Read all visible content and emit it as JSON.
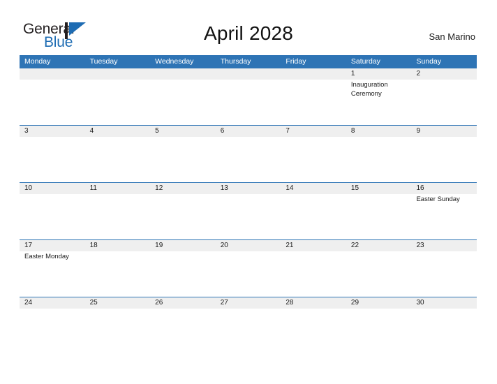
{
  "brand": {
    "name_part1": "General",
    "name_part2": "Blue",
    "mark": "flag-triangle-icon",
    "accent_color": "#1e6cb3"
  },
  "header": {
    "title": "April 2028",
    "locale": "San Marino"
  },
  "colors": {
    "header_blue": "#2e74b5",
    "daynum_band_gray": "#efefef",
    "cell_background": "#fdfdfd",
    "text": "#1a1a1a"
  },
  "calendar": {
    "weekdays": [
      "Monday",
      "Tuesday",
      "Wednesday",
      "Thursday",
      "Friday",
      "Saturday",
      "Sunday"
    ],
    "weeks": [
      [
        {
          "day": "",
          "event": ""
        },
        {
          "day": "",
          "event": ""
        },
        {
          "day": "",
          "event": ""
        },
        {
          "day": "",
          "event": ""
        },
        {
          "day": "",
          "event": ""
        },
        {
          "day": "1",
          "event": "Inauguration Ceremony"
        },
        {
          "day": "2",
          "event": ""
        }
      ],
      [
        {
          "day": "3",
          "event": ""
        },
        {
          "day": "4",
          "event": ""
        },
        {
          "day": "5",
          "event": ""
        },
        {
          "day": "6",
          "event": ""
        },
        {
          "day": "7",
          "event": ""
        },
        {
          "day": "8",
          "event": ""
        },
        {
          "day": "9",
          "event": ""
        }
      ],
      [
        {
          "day": "10",
          "event": ""
        },
        {
          "day": "11",
          "event": ""
        },
        {
          "day": "12",
          "event": ""
        },
        {
          "day": "13",
          "event": ""
        },
        {
          "day": "14",
          "event": ""
        },
        {
          "day": "15",
          "event": ""
        },
        {
          "day": "16",
          "event": "Easter Sunday"
        }
      ],
      [
        {
          "day": "17",
          "event": "Easter Monday"
        },
        {
          "day": "18",
          "event": ""
        },
        {
          "day": "19",
          "event": ""
        },
        {
          "day": "20",
          "event": ""
        },
        {
          "day": "21",
          "event": ""
        },
        {
          "day": "22",
          "event": ""
        },
        {
          "day": "23",
          "event": ""
        }
      ],
      [
        {
          "day": "24",
          "event": ""
        },
        {
          "day": "25",
          "event": ""
        },
        {
          "day": "26",
          "event": ""
        },
        {
          "day": "27",
          "event": ""
        },
        {
          "day": "28",
          "event": ""
        },
        {
          "day": "29",
          "event": ""
        },
        {
          "day": "30",
          "event": ""
        }
      ]
    ]
  }
}
